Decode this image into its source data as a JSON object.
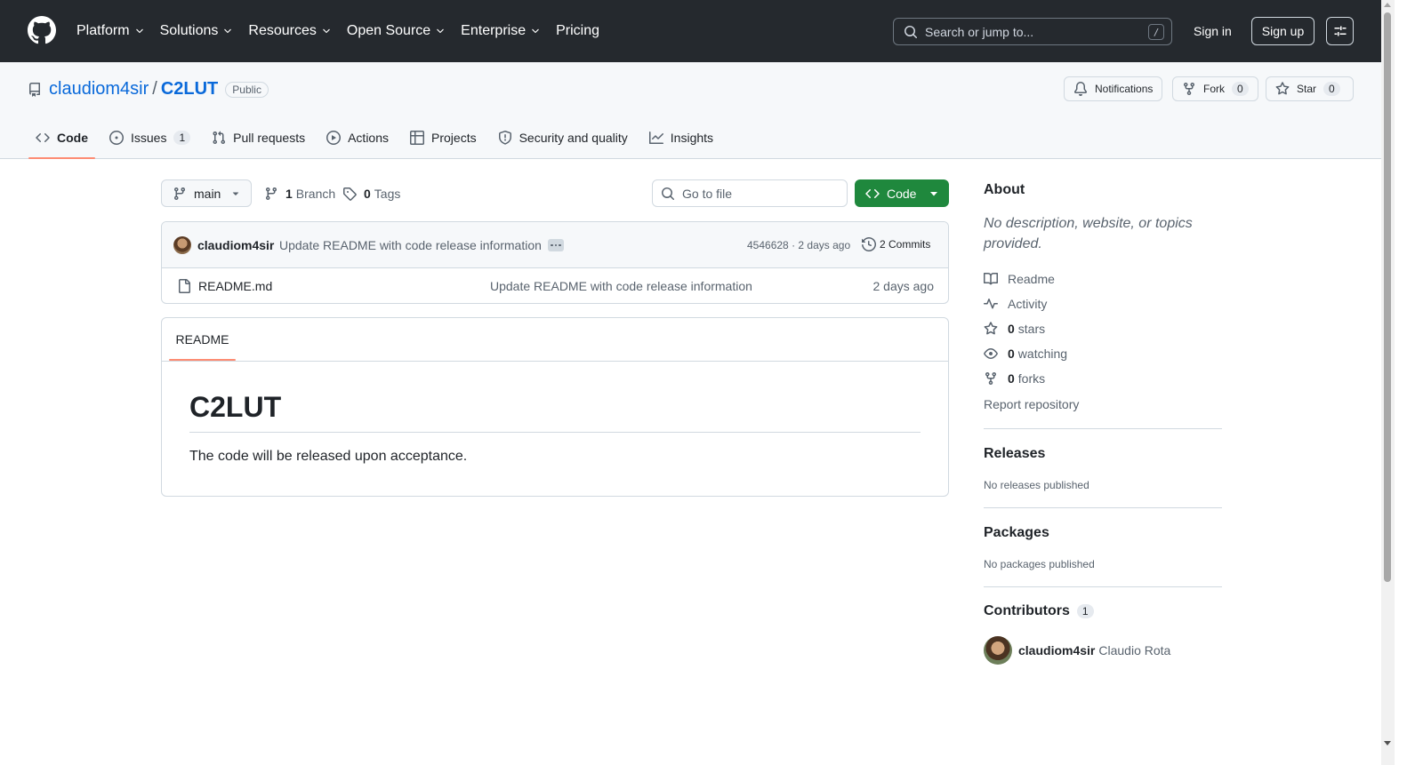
{
  "header": {
    "nav": [
      {
        "label": "Platform",
        "has_menu": true
      },
      {
        "label": "Solutions",
        "has_menu": true
      },
      {
        "label": "Resources",
        "has_menu": true
      },
      {
        "label": "Open Source",
        "has_menu": true
      },
      {
        "label": "Enterprise",
        "has_menu": true
      },
      {
        "label": "Pricing",
        "has_menu": false
      }
    ],
    "search_placeholder": "Search or jump to...",
    "search_shortcut": "/",
    "sign_in": "Sign in",
    "sign_up": "Sign up"
  },
  "repo": {
    "owner": "claudiom4sir",
    "separator": "/",
    "name": "C2LUT",
    "visibility": "Public",
    "notifications_label": "Notifications",
    "fork_label": "Fork",
    "fork_count": "0",
    "star_label": "Star",
    "star_count": "0",
    "tabs": [
      {
        "label": "Code",
        "icon": "code-icon",
        "active": true
      },
      {
        "label": "Issues",
        "icon": "issue-icon",
        "count": "1"
      },
      {
        "label": "Pull requests",
        "icon": "pull-request-icon"
      },
      {
        "label": "Actions",
        "icon": "play-icon"
      },
      {
        "label": "Projects",
        "icon": "table-icon"
      },
      {
        "label": "Security and quality",
        "icon": "shield-icon"
      },
      {
        "label": "Insights",
        "icon": "graph-icon"
      }
    ]
  },
  "toolbar": {
    "branch": "main",
    "branch_count": "1",
    "branch_label": "Branch",
    "tag_count": "0",
    "tag_label": "Tags",
    "goto_placeholder": "Go to file",
    "code_button": "Code"
  },
  "commit": {
    "author": "claudiom4sir",
    "message": "Update README with code release information",
    "hash": "4546628",
    "time": "2 days ago",
    "hash_time_sep": "·",
    "commits_label": "2 Commits"
  },
  "files": [
    {
      "name": "README.md",
      "message": "Update README with code release information",
      "time": "2 days ago"
    }
  ],
  "readme": {
    "tab": "README",
    "heading": "C2LUT",
    "body": "The code will be released upon acceptance."
  },
  "sidebar": {
    "about_title": "About",
    "about_desc": "No description, website, or topics provided.",
    "readme_link": "Readme",
    "activity_link": "Activity",
    "stars_count": "0",
    "stars_label": "stars",
    "watching_count": "0",
    "watching_label": "watching",
    "forks_count": "0",
    "forks_label": "forks",
    "report": "Report repository",
    "releases_title": "Releases",
    "releases_desc": "No releases published",
    "packages_title": "Packages",
    "packages_desc": "No packages published",
    "contributors_title": "Contributors",
    "contributors_count": "1",
    "contributor_login": "claudiom4sir",
    "contributor_name": "Claudio Rota"
  },
  "colors": {
    "header_bg": "#25292e",
    "link": "#0969da",
    "code_button": "#1f883d",
    "tab_underline": "#fd8c73"
  }
}
